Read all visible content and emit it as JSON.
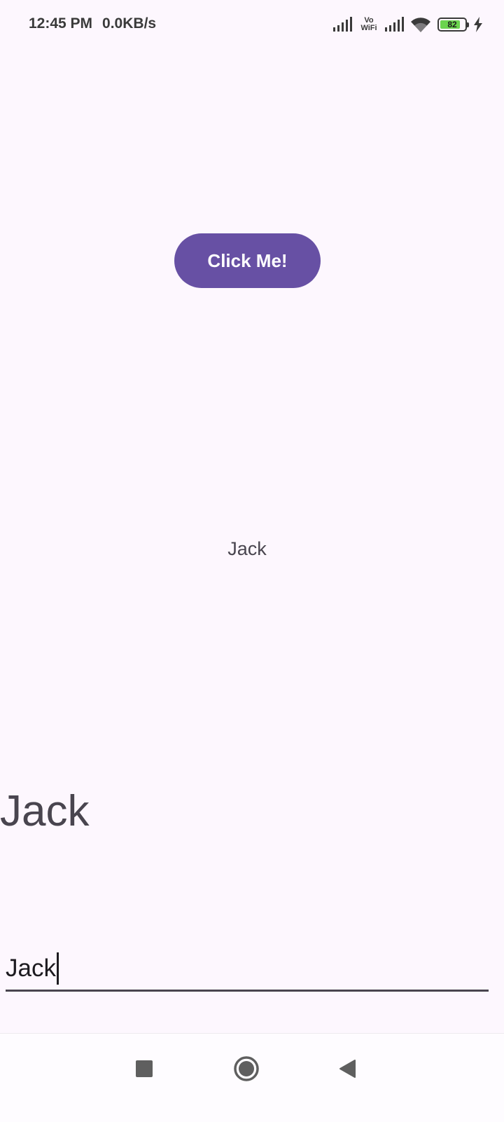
{
  "status_bar": {
    "time": "12:45 PM",
    "net_speed": "0.0KB/s",
    "vowifi_top": "Vo",
    "vowifi_bottom": "WiFi",
    "battery_level": "82",
    "battery_percent": 82,
    "icons": [
      "signal-icon",
      "vowifi-icon",
      "signal-icon",
      "wifi-icon",
      "battery-icon",
      "charging-icon"
    ]
  },
  "main": {
    "button_label": "Click Me!",
    "center_text": "Jack",
    "large_text": "Jack",
    "input_value": "Jack"
  },
  "nav_bar": {
    "icons": [
      "recent-apps-icon",
      "home-icon",
      "back-icon"
    ]
  },
  "colors": {
    "background": "#fdf7fe",
    "accent": "#6750a4",
    "text": "#49454f"
  }
}
